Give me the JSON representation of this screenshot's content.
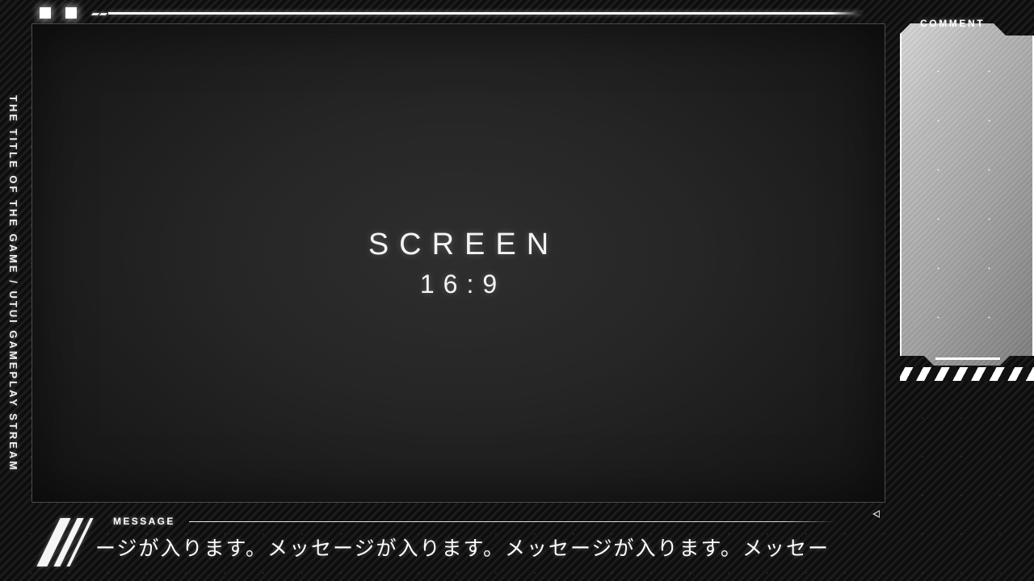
{
  "stream": {
    "title_rail": "THE TITLE OF THE GAME / UTUI GAMEPLAY STREAM",
    "accent_color": "#ffffff",
    "background_color": "#111111"
  },
  "screen": {
    "label": "SCREEN",
    "ratio": "16:9"
  },
  "comment": {
    "label": "COMMENT",
    "panel_color": "#a5a5a5"
  },
  "message": {
    "label": "MESSAGE",
    "text": "ージが入ります。メッセージが入ります。メッセージが入ります。メッセー"
  },
  "top_bar": {
    "indicator_1": "",
    "indicator_2": ""
  }
}
